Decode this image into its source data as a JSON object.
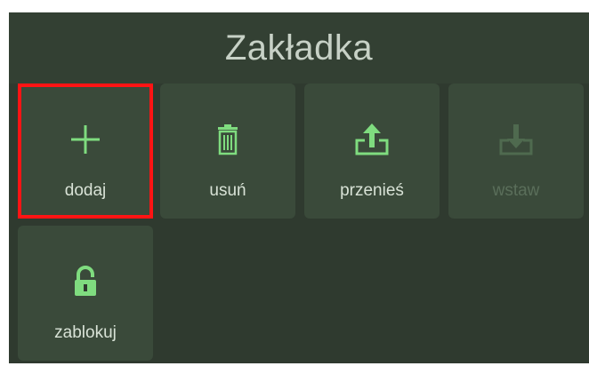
{
  "header": {
    "title": "Zakładka"
  },
  "actions": [
    {
      "label": "dodaj",
      "icon": "plus-icon",
      "enabled": true,
      "highlighted": true
    },
    {
      "label": "usuń",
      "icon": "trash-icon",
      "enabled": true,
      "highlighted": false
    },
    {
      "label": "przenieś",
      "icon": "upload-icon",
      "enabled": true,
      "highlighted": false
    },
    {
      "label": "wstaw",
      "icon": "download-icon",
      "enabled": false,
      "highlighted": false
    },
    {
      "label": "zablokuj",
      "icon": "lock-icon",
      "enabled": true,
      "highlighted": false
    }
  ],
  "colors": {
    "background": "#2f3a2f",
    "tile": "#3a4a3a",
    "accent_green": "#7fdc7f",
    "disabled_green": "#4f6a4f",
    "highlight_border": "#ff1414"
  }
}
